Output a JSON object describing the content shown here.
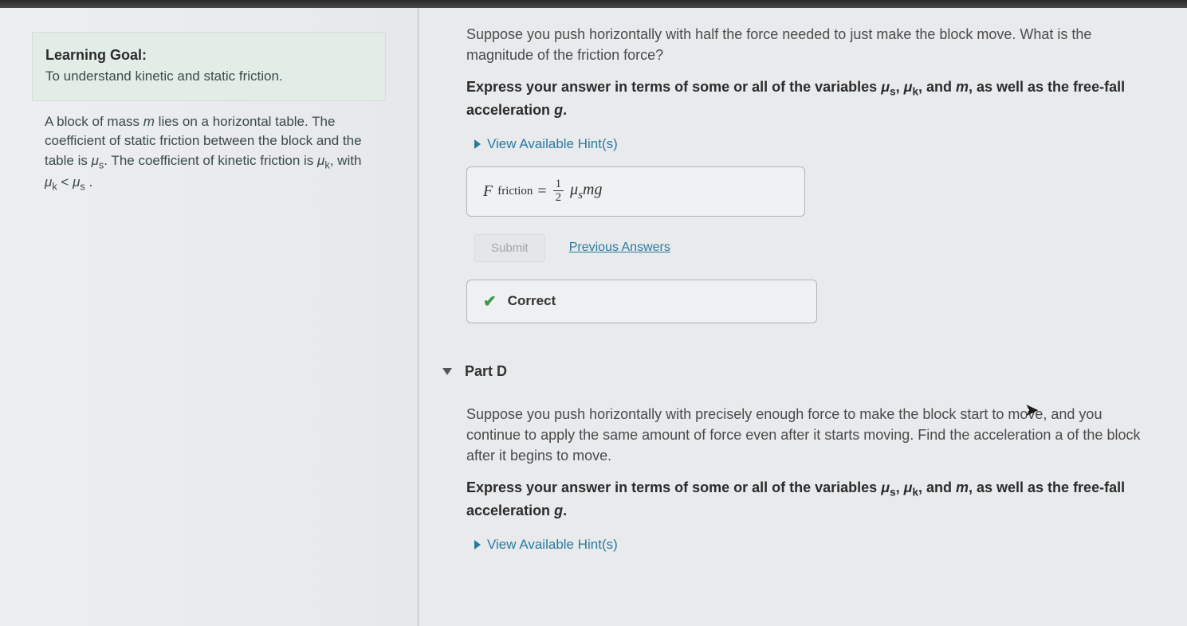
{
  "sidebar": {
    "goal_title": "Learning Goal:",
    "goal_text": "To understand kinetic and static friction.",
    "setup_html": "A block of mass <span class='ital'>m</span> lies on a horizontal table. The coefficient of static friction between the block and the table is <span class='ital'>μ</span><span class='sub'>s</span>. The coefficient of kinetic friction is <span class='ital'>μ</span><span class='sub'>k</span>, with <span class='ital'>μ</span><span class='sub'>k</span> &lt; <span class='ital'>μ</span><span class='sub'>s</span> ."
  },
  "partC": {
    "question": "Suppose you push horizontally with half the force needed to just make the block move. What is the magnitude of the friction force?",
    "express_html": "<b>Express your answer in terms of some or all of the variables <span class='ital'>μ</span><span class='sub'>s</span>, <span class='ital'>μ</span><span class='sub'>k</span>, and <span class='ital'>m</span>, as well as the free-fall acceleration <span class='ital'>g</span>.</b>",
    "hints_label": "View Available Hint(s)",
    "answer_lhs": "F",
    "answer_sub": "friction",
    "answer_eq": " = ",
    "answer_frac_num": "1",
    "answer_frac_den": "2",
    "answer_rhs_html": "<span class='ital'>μ</span><span class='sub ital'>s</span><span class='ital'>mg</span>",
    "submit_label": "Submit",
    "prev_label": "Previous Answers",
    "feedback": "Correct"
  },
  "partD": {
    "title": "Part D",
    "question": "Suppose you push horizontally with precisely enough force to make the block start to move, and you continue to apply the same amount of force even after it starts moving. Find the acceleration a of the block after it begins to move.",
    "express_html": "<b>Express your answer in terms of some or all of the variables <span class='ital'>μ</span><span class='sub'>s</span>, <span class='ital'>μ</span><span class='sub'>k</span>, and <span class='ital'>m</span>, as well as the free-fall acceleration <span class='ital'>g</span>.</b>",
    "hints_label": "View Available Hint(s)"
  }
}
